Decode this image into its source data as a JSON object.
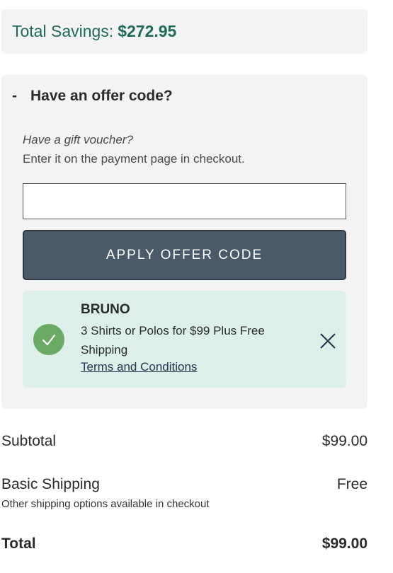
{
  "savings": {
    "label": "Total Savings:",
    "amount": "$272.95"
  },
  "offer": {
    "toggle_symbol": "-",
    "heading": "Have an offer code?",
    "gift_question": "Have a gift voucher?",
    "gift_hint": "Enter it on the payment page in checkout.",
    "input_value": "",
    "apply_label": "APPLY OFFER CODE",
    "applied": {
      "code": "BRUNO",
      "description": "3 Shirts or Polos for $99 Plus Free Shipping",
      "terms_label": "Terms and Conditions",
      "status_icon": "check-icon",
      "remove_icon": "close-icon"
    }
  },
  "summary": {
    "subtotal_label": "Subtotal",
    "subtotal_value": "$99.00",
    "shipping_label": "Basic Shipping",
    "shipping_value": "Free",
    "shipping_note": "Other shipping options available in checkout",
    "total_label": "Total",
    "total_value": "$99.00"
  },
  "colors": {
    "savings_text": "#1e6b5b",
    "button_bg": "#4a5a68",
    "promo_bg": "#dcefe9",
    "check_green": "#6aaa64"
  }
}
